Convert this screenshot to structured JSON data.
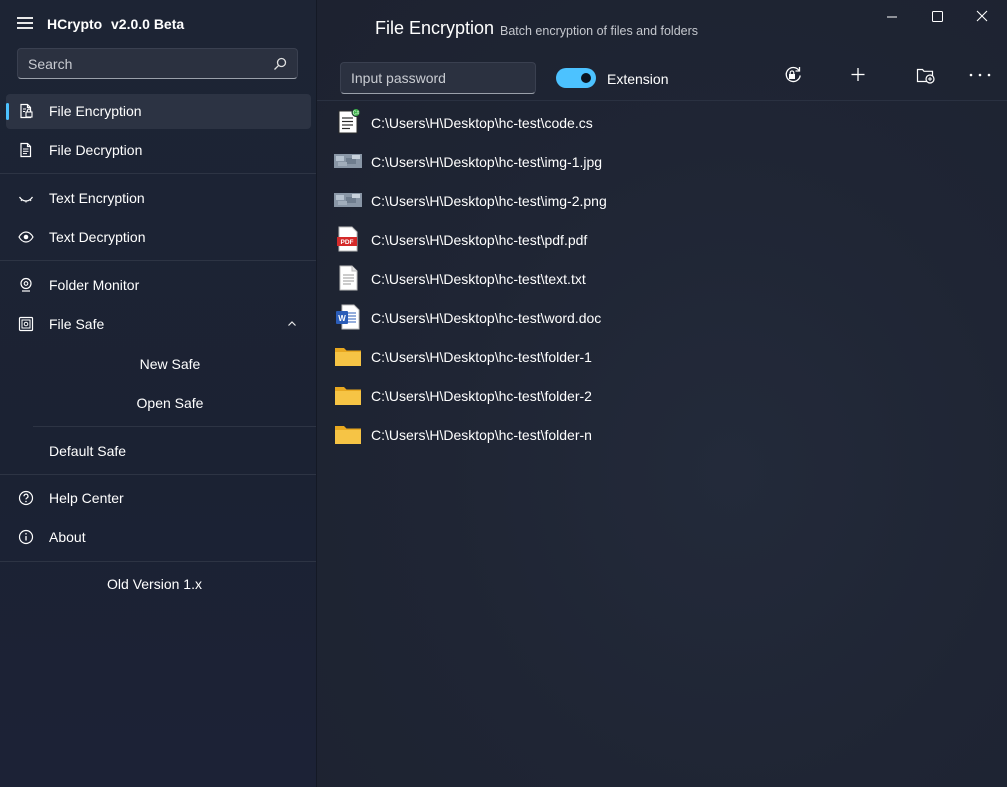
{
  "app": {
    "name": "HCrypto",
    "version": "v2.0.0 Beta"
  },
  "search": {
    "placeholder": "Search"
  },
  "sidebar": {
    "items": [
      {
        "label": "File Encryption",
        "icon": "file-lock-icon",
        "selected": true
      },
      {
        "label": "File Decryption",
        "icon": "file-text-icon"
      },
      {
        "label": "Text Encryption",
        "icon": "eye-closed-icon"
      },
      {
        "label": "Text Decryption",
        "icon": "eye-icon"
      },
      {
        "label": "Folder Monitor",
        "icon": "webcam-icon"
      },
      {
        "label": "File Safe",
        "icon": "safe-icon",
        "expanded": true
      },
      {
        "label": "Help Center",
        "icon": "help-icon"
      },
      {
        "label": "About",
        "icon": "info-icon"
      }
    ],
    "safe_subitems": [
      "New Safe",
      "Open Safe"
    ],
    "default_safe": "Default Safe",
    "old_version": "Old Version 1.x"
  },
  "header": {
    "title": "File Encryption",
    "subtitle": "Batch encryption of files and folders"
  },
  "toolbar": {
    "password_placeholder": "Input password",
    "extension_label": "Extension",
    "extension_on": true,
    "buttons": [
      "lock-refresh-icon",
      "add-icon",
      "add-folder-icon",
      "more-icon"
    ]
  },
  "files": [
    {
      "path": "C:\\Users\\H\\Desktop\\hc-test\\code.cs",
      "type": "code"
    },
    {
      "path": "C:\\Users\\H\\Desktop\\hc-test\\img-1.jpg",
      "type": "image"
    },
    {
      "path": "C:\\Users\\H\\Desktop\\hc-test\\img-2.png",
      "type": "image"
    },
    {
      "path": "C:\\Users\\H\\Desktop\\hc-test\\pdf.pdf",
      "type": "pdf"
    },
    {
      "path": "C:\\Users\\H\\Desktop\\hc-test\\text.txt",
      "type": "text"
    },
    {
      "path": "C:\\Users\\H\\Desktop\\hc-test\\word.doc",
      "type": "word"
    },
    {
      "path": "C:\\Users\\H\\Desktop\\hc-test\\folder-1",
      "type": "folder"
    },
    {
      "path": "C:\\Users\\H\\Desktop\\hc-test\\folder-2",
      "type": "folder"
    },
    {
      "path": "C:\\Users\\H\\Desktop\\hc-test\\folder-n",
      "type": "folder"
    }
  ],
  "colors": {
    "accent": "#4cc2ff",
    "sidebar_bg": "#1d2434",
    "main_bg": "#1f2533",
    "folder": "#f6c445",
    "pdf": "#d42a2a",
    "word": "#2b5db8"
  }
}
